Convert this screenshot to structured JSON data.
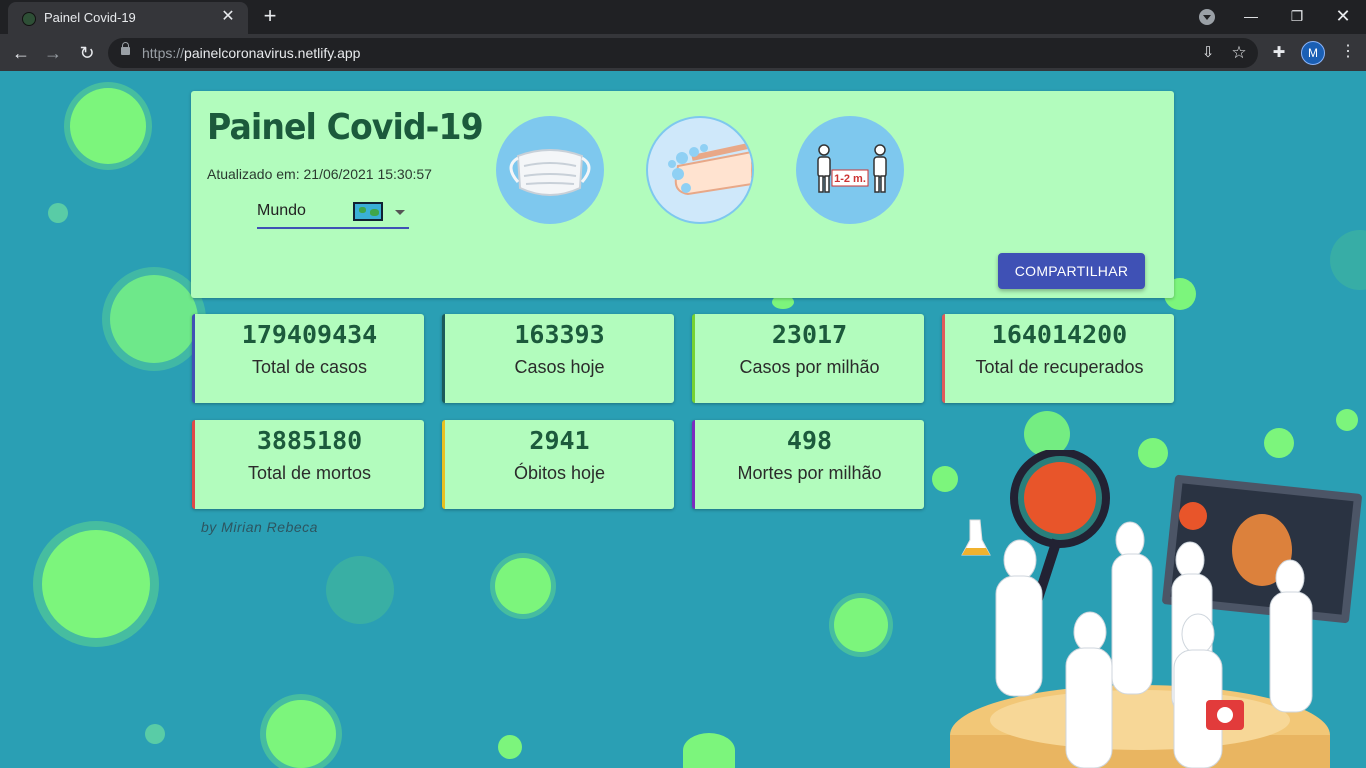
{
  "browser": {
    "tab_title": "Painel Covid-19",
    "url_scheme": "https://",
    "url_host": "painelcoronavirus.netlify.app",
    "profile_initial": "M"
  },
  "header": {
    "title": "Painel Covid-19",
    "updated_label": "Atualizado em: 21/06/2021 15:30:57",
    "region_select": "Mundo",
    "share_label": "COMPARTILHAR",
    "distance_text": "1-2 m."
  },
  "stats": [
    {
      "value": "179409434",
      "label": "Total de casos",
      "color": "#3f51b5"
    },
    {
      "value": "163393",
      "label": "Casos hoje",
      "color": "#1c5a5a"
    },
    {
      "value": "23017",
      "label": "Casos por milhão",
      "color": "#76d132"
    },
    {
      "value": "164014200",
      "label": "Total de recuperados",
      "color": "#e05a5a"
    },
    {
      "value": "3885180",
      "label": "Total de mortos",
      "color": "#e04848"
    },
    {
      "value": "2941",
      "label": "Óbitos hoje",
      "color": "#e8c020"
    },
    {
      "value": "498",
      "label": "Mortes por milhão",
      "color": "#7b2cbf"
    }
  ],
  "footer": {
    "author": "by Mirian Rebeca"
  },
  "colors": {
    "background": "#2a9fb4",
    "panel": "#b2fcbd",
    "accent": "#3f51b5",
    "virus": "#7cf57c"
  }
}
